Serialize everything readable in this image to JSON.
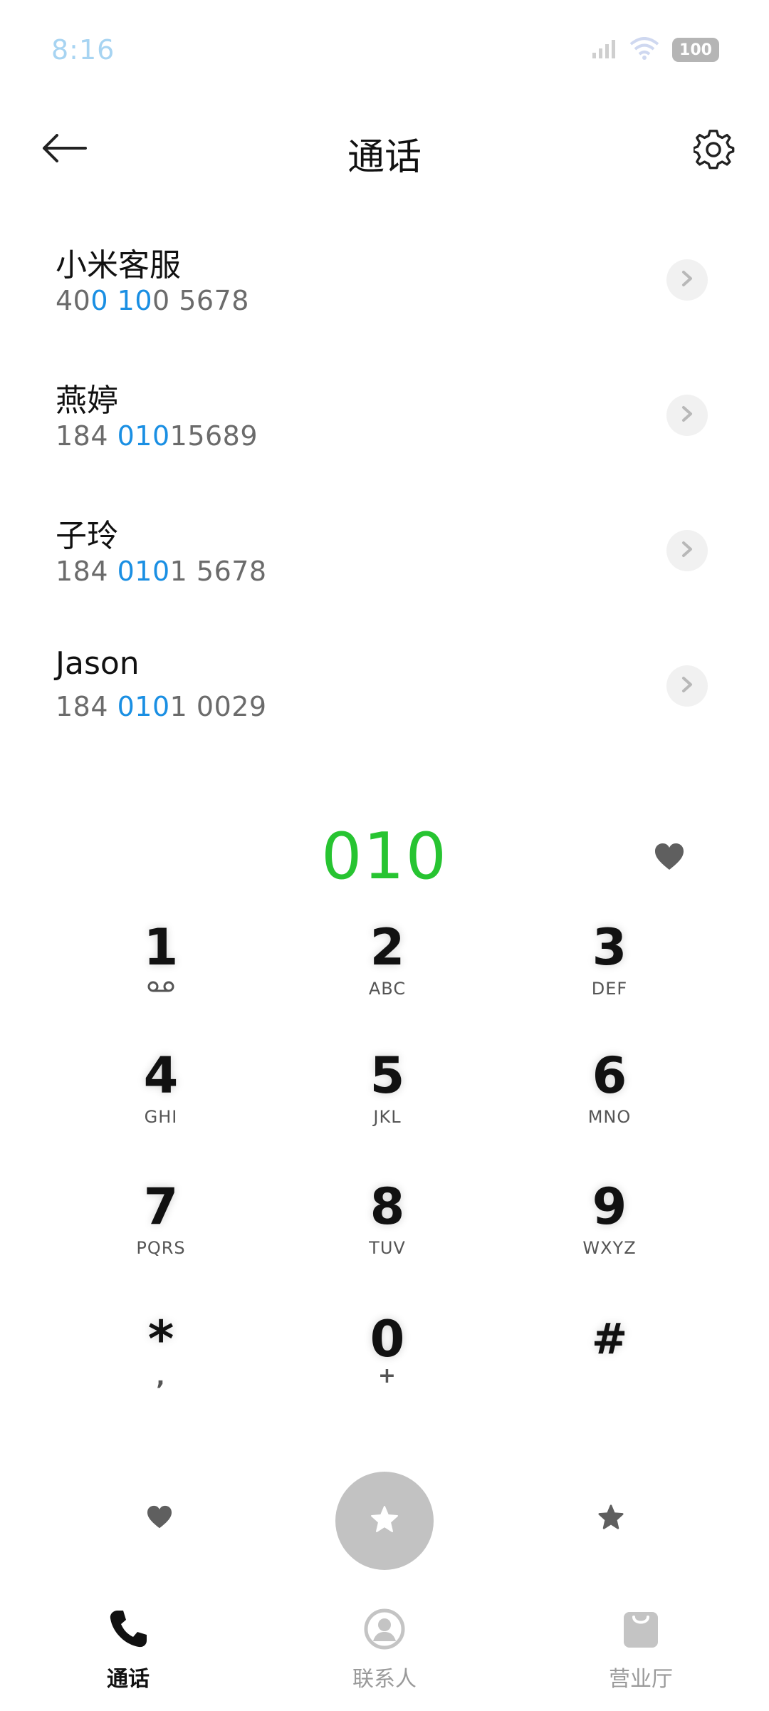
{
  "status_bar": {
    "time": "8:16",
    "battery": "100"
  },
  "header": {
    "title": "通话"
  },
  "suggestions": [
    {
      "name": "小米客服",
      "number_parts": [
        "40",
        "0",
        " ",
        "10",
        "0 5678"
      ]
    },
    {
      "name": "燕婷",
      "number_parts": [
        "184 ",
        "010",
        "15689",
        "",
        ""
      ]
    },
    {
      "name": "子玲",
      "number_parts": [
        "184 ",
        "010",
        "1 5678",
        "",
        ""
      ]
    },
    {
      "name": "Jason",
      "number_parts": [
        "184 ",
        "010",
        "1 0029",
        "",
        ""
      ]
    }
  ],
  "dialed_number": "010",
  "keypad": [
    {
      "digit": "1",
      "letters": ""
    },
    {
      "digit": "2",
      "letters": "ABC"
    },
    {
      "digit": "3",
      "letters": "DEF"
    },
    {
      "digit": "4",
      "letters": "GHI"
    },
    {
      "digit": "5",
      "letters": "JKL"
    },
    {
      "digit": "6",
      "letters": "MNO"
    },
    {
      "digit": "7",
      "letters": "PQRS"
    },
    {
      "digit": "8",
      "letters": "TUV"
    },
    {
      "digit": "9",
      "letters": "WXYZ"
    },
    {
      "digit": "*",
      "letters": ","
    },
    {
      "digit": "0",
      "letters": "+"
    },
    {
      "digit": "#",
      "letters": ""
    }
  ],
  "bottom_nav": [
    {
      "label": "通话",
      "icon": "phone-icon",
      "active": true
    },
    {
      "label": "联系人",
      "icon": "contacts-icon",
      "active": false
    },
    {
      "label": "营业厅",
      "icon": "shopping-bag-icon",
      "active": false
    }
  ],
  "colors": {
    "accent_green": "#27c431",
    "highlight_blue": "#1a8fe3",
    "call_button": "#c2c2c2"
  }
}
